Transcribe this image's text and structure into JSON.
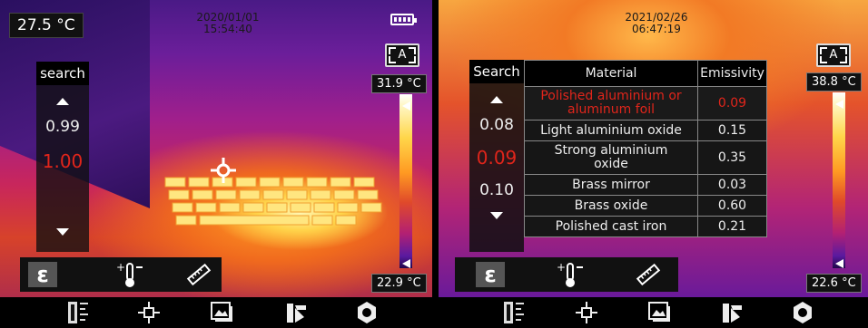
{
  "left_screen": {
    "spot_temp": "27.5 °C",
    "date": "2020/01/01",
    "time": "15:54:40",
    "search_label": "search",
    "emissivity_values": [
      "0.99",
      "1.00"
    ],
    "max_temp": "31.9 °C",
    "min_temp": "22.9 °C",
    "auto_label": "A"
  },
  "right_screen": {
    "date": "2021/02/26",
    "time": "06:47:19",
    "search_label": "Search",
    "emissivity_values": [
      "0.08",
      "0.09",
      "0.10"
    ],
    "max_temp": "38.8 °C",
    "min_temp": "22.6 °C",
    "auto_label": "A",
    "table": {
      "headers": [
        "Material",
        "Emissivity"
      ],
      "rows": [
        {
          "material": "Polished aluminium or aluminum foil",
          "emissivity": "0.09",
          "selected": true
        },
        {
          "material": "Light aluminium oxide",
          "emissivity": "0.15"
        },
        {
          "material": "Strong aluminium oxide",
          "emissivity": "0.35"
        },
        {
          "material": "Brass mirror",
          "emissivity": "0.03"
        },
        {
          "material": "Brass oxide",
          "emissivity": "0.60"
        },
        {
          "material": "Polished cast iron",
          "emissivity": "0.21"
        }
      ]
    }
  },
  "toolbar": {
    "epsilon_label": "ε",
    "icons": [
      "emissivity-icon",
      "temperature-range-icon",
      "distance-icon"
    ]
  },
  "bottom_bar": {
    "icons": [
      "thermometer-icon",
      "crosshair-icon",
      "gallery-icon",
      "palette-icon",
      "settings-icon"
    ]
  },
  "colors": {
    "selected_red": "#e0251b",
    "panel_bg": "#111111"
  }
}
